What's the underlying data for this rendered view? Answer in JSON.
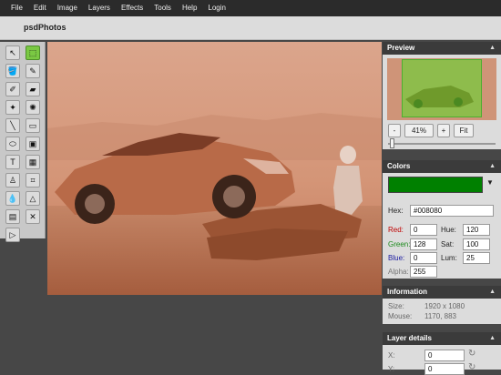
{
  "menu": [
    "File",
    "Edit",
    "Image",
    "Layers",
    "Effects",
    "Tools",
    "Help",
    "Login"
  ],
  "app": {
    "title": "psdPhotos"
  },
  "tools": [
    {
      "name": "pointer-icon",
      "glyph": "↖"
    },
    {
      "name": "marquee-select-icon",
      "glyph": "⬚"
    },
    {
      "name": "fill-bucket-icon",
      "glyph": "🪣"
    },
    {
      "name": "brush-icon",
      "glyph": "✎"
    },
    {
      "name": "eyedropper-icon",
      "glyph": "✐"
    },
    {
      "name": "eraser-icon",
      "glyph": "▰"
    },
    {
      "name": "magic-wand-icon",
      "glyph": "✦"
    },
    {
      "name": "clone-stamp-icon",
      "glyph": "✺"
    },
    {
      "name": "line-icon",
      "glyph": "╲"
    },
    {
      "name": "rectangle-icon",
      "glyph": "▭"
    },
    {
      "name": "blur-icon",
      "glyph": "⬭"
    },
    {
      "name": "image-icon",
      "glyph": "▣"
    },
    {
      "name": "text-icon",
      "glyph": "T"
    },
    {
      "name": "gradient-icon",
      "glyph": "▦"
    },
    {
      "name": "stamp-icon",
      "glyph": "♙"
    },
    {
      "name": "crop-icon",
      "glyph": "⌗"
    },
    {
      "name": "drop-icon",
      "glyph": "💧"
    },
    {
      "name": "sharpen-icon",
      "glyph": "△"
    },
    {
      "name": "bandage-icon",
      "glyph": "▤"
    },
    {
      "name": "shrink-icon",
      "glyph": "✕"
    },
    {
      "name": "animation-icon",
      "glyph": "▷"
    }
  ],
  "preview": {
    "title": "Preview",
    "zoom": "41%",
    "minus": "-",
    "plus": "+",
    "fit": "Fit",
    "zoom_level": 0.02
  },
  "colors": {
    "title": "Colors",
    "swatch": "#008000",
    "hex_label": "Hex:",
    "hex": "#008080",
    "red_label": "Red:",
    "red": "0",
    "green_label": "Green:",
    "green": "128",
    "blue_label": "Blue:",
    "blue": "0",
    "alpha_label": "Alpha:",
    "alpha": "255",
    "hue_label": "Hue:",
    "hue": "120",
    "sat_label": "Sat:",
    "sat": "100",
    "lum_label": "Lum:",
    "lum": "25",
    "red_color": "#c00000",
    "green_color": "#1d8a1d",
    "blue_color": "#1a1aa0"
  },
  "information": {
    "title": "Information",
    "size_label": "Size:",
    "size": "1920 x 1080",
    "mouse_label": "Mouse:",
    "mouse": "1170, 883"
  },
  "layer_details": {
    "title": "Layer details",
    "x_label": "X:",
    "x": "0",
    "y_label": "Y:",
    "y": "0"
  },
  "collapse_glyph": "▲",
  "dropdown_glyph": "▼",
  "reset_glyph": "↻"
}
